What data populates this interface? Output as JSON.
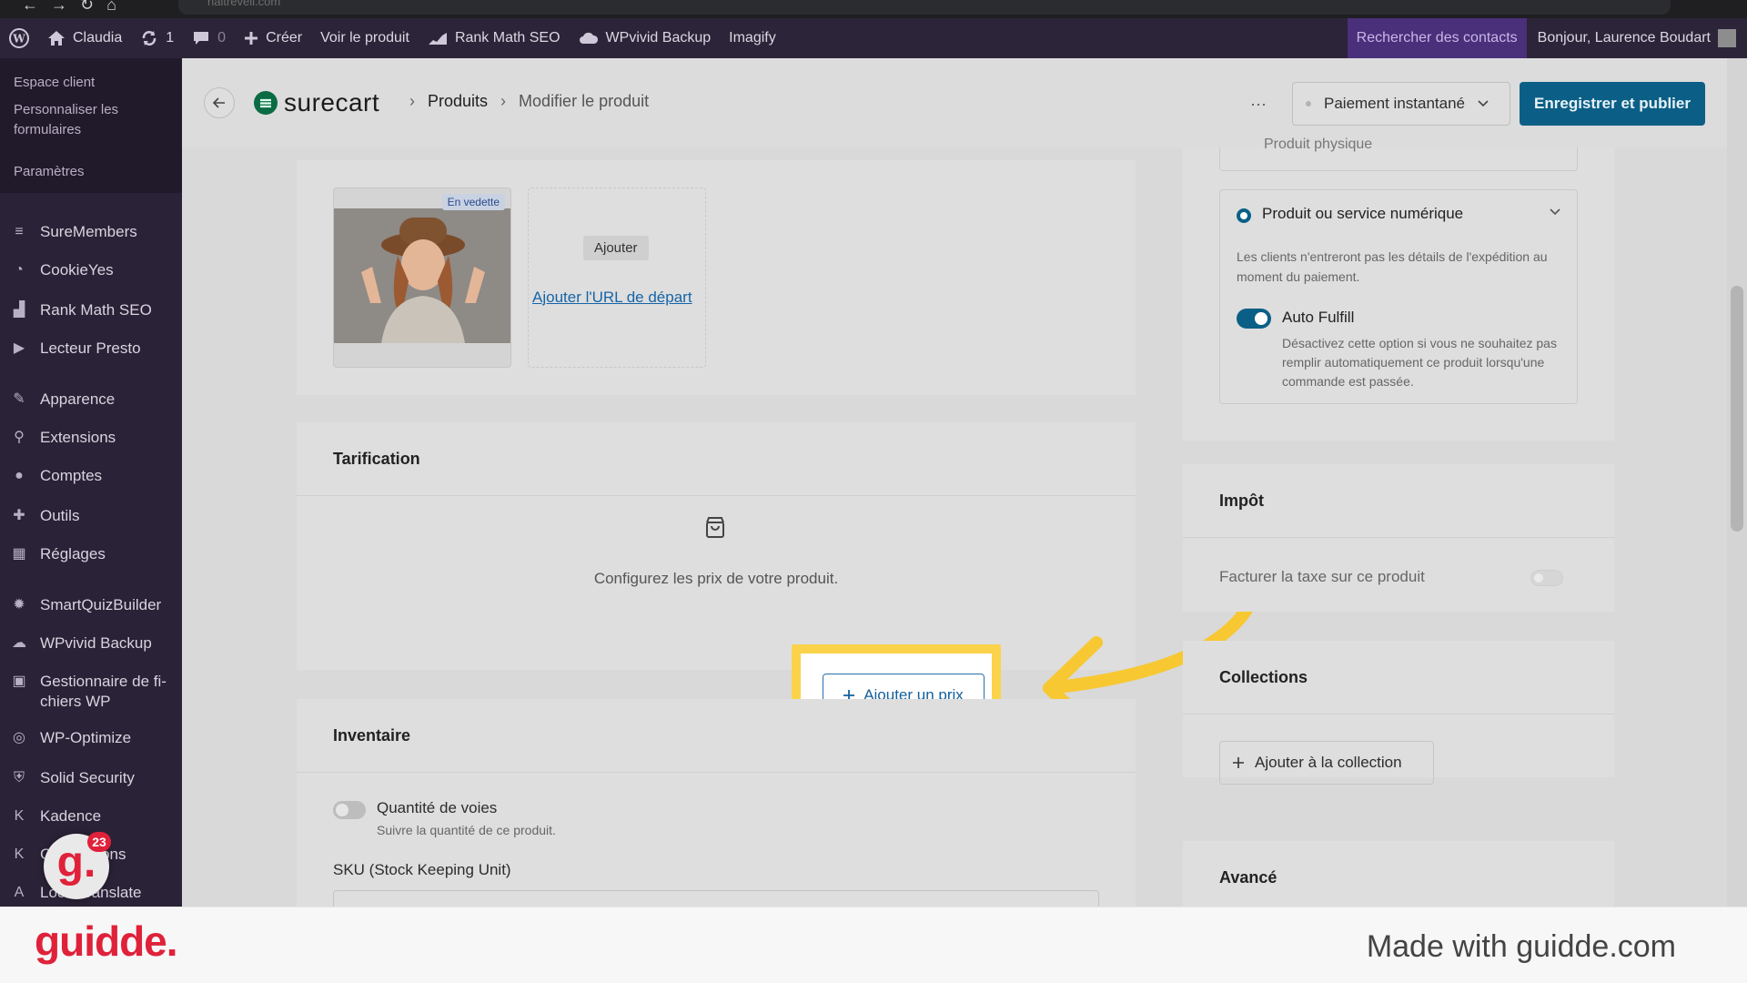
{
  "browser": {
    "url": "naitrevell.com"
  },
  "adminbar": {
    "site": "Claudia",
    "updates": "1",
    "comments": "0",
    "create": "Créer",
    "view_product": "Voir le produit",
    "rankmath": "Rank Math SEO",
    "wpvivid": "WPvivid Backup",
    "imagify": "Imagify",
    "search_contacts": "Rechercher des contacts",
    "greeting": "Bonjour, Laurence Boudart"
  },
  "sidebar": {
    "sub_items": [
      "Espace client",
      "Personnaliser les formulaires",
      "Paramètres"
    ],
    "items": [
      {
        "label": "SureMembers",
        "icon": "suremembers-icon"
      },
      {
        "label": "CookieYes",
        "icon": "cookie-icon"
      },
      {
        "label": "Rank Math SEO",
        "icon": "chart-icon"
      },
      {
        "label": "Lecteur Presto",
        "icon": "play-icon"
      },
      {
        "label": "Apparence",
        "icon": "brush-icon"
      },
      {
        "label": "Extensions",
        "icon": "plugin-icon"
      },
      {
        "label": "Comptes",
        "icon": "user-icon"
      },
      {
        "label": "Outils",
        "icon": "wrench-icon"
      },
      {
        "label": "Réglages",
        "icon": "settings-icon"
      },
      {
        "label": "SmartQuizBuilder",
        "icon": "gear-icon"
      },
      {
        "label": "WPvivid Backup",
        "icon": "cloud-icon"
      },
      {
        "label": "Gestionnaire de fi-chiers WP",
        "icon": "folder-icon"
      },
      {
        "label": "WP-Optimize",
        "icon": "optimize-icon"
      },
      {
        "label": "Solid Security",
        "icon": "shield-icon"
      },
      {
        "label": "Kadence",
        "icon": "kadence-icon"
      },
      {
        "label": "Conversions",
        "icon": "kadence-icon"
      },
      {
        "label": "Loco Translate",
        "icon": "translate-icon"
      }
    ]
  },
  "header": {
    "logo": "surecart",
    "breadcrumb_1": "Produits",
    "breadcrumb_2": "Modifier le produit",
    "more": "···",
    "payment_select": "Paiement instantané",
    "publish": "Enregistrer et publier"
  },
  "media": {
    "badge": "En vedette",
    "add_button": "Ajouter",
    "add_url_link": "Ajouter l'URL de départ"
  },
  "pricing": {
    "title": "Tarification",
    "empty_text": "Configurez les prix de votre produit.",
    "add_price": "Ajouter un prix"
  },
  "inventory": {
    "title": "Inventaire",
    "track_label": "Quantité de voies",
    "track_help": "Suivre la quantité de ce produit.",
    "sku_label": "SKU (Stock Keeping Unit)"
  },
  "product_type": {
    "physical": "Produit physique",
    "digital": "Produit ou service numérique",
    "digital_desc": "Les clients n'entreront pas les détails de l'expédition au moment du paiement.",
    "auto_fulfill": "Auto Fulfill",
    "auto_fulfill_desc": "Désactivez cette option si vous ne souhaitez pas remplir automatiquement ce produit lorsqu'une commande est passée."
  },
  "tax": {
    "title": "Impôt",
    "label": "Facturer la taxe sur ce produit"
  },
  "collections": {
    "title": "Collections",
    "add": "Ajouter à la collection"
  },
  "advanced": {
    "title": "Avancé"
  },
  "guidde": {
    "count": "23",
    "brand": "guidde.",
    "made_with": "Made with guidde.com"
  },
  "colors": {
    "accent": "#0b5f86",
    "highlight": "#fbd34b",
    "arrow": "#f7c832",
    "brand": "#e0213a"
  }
}
